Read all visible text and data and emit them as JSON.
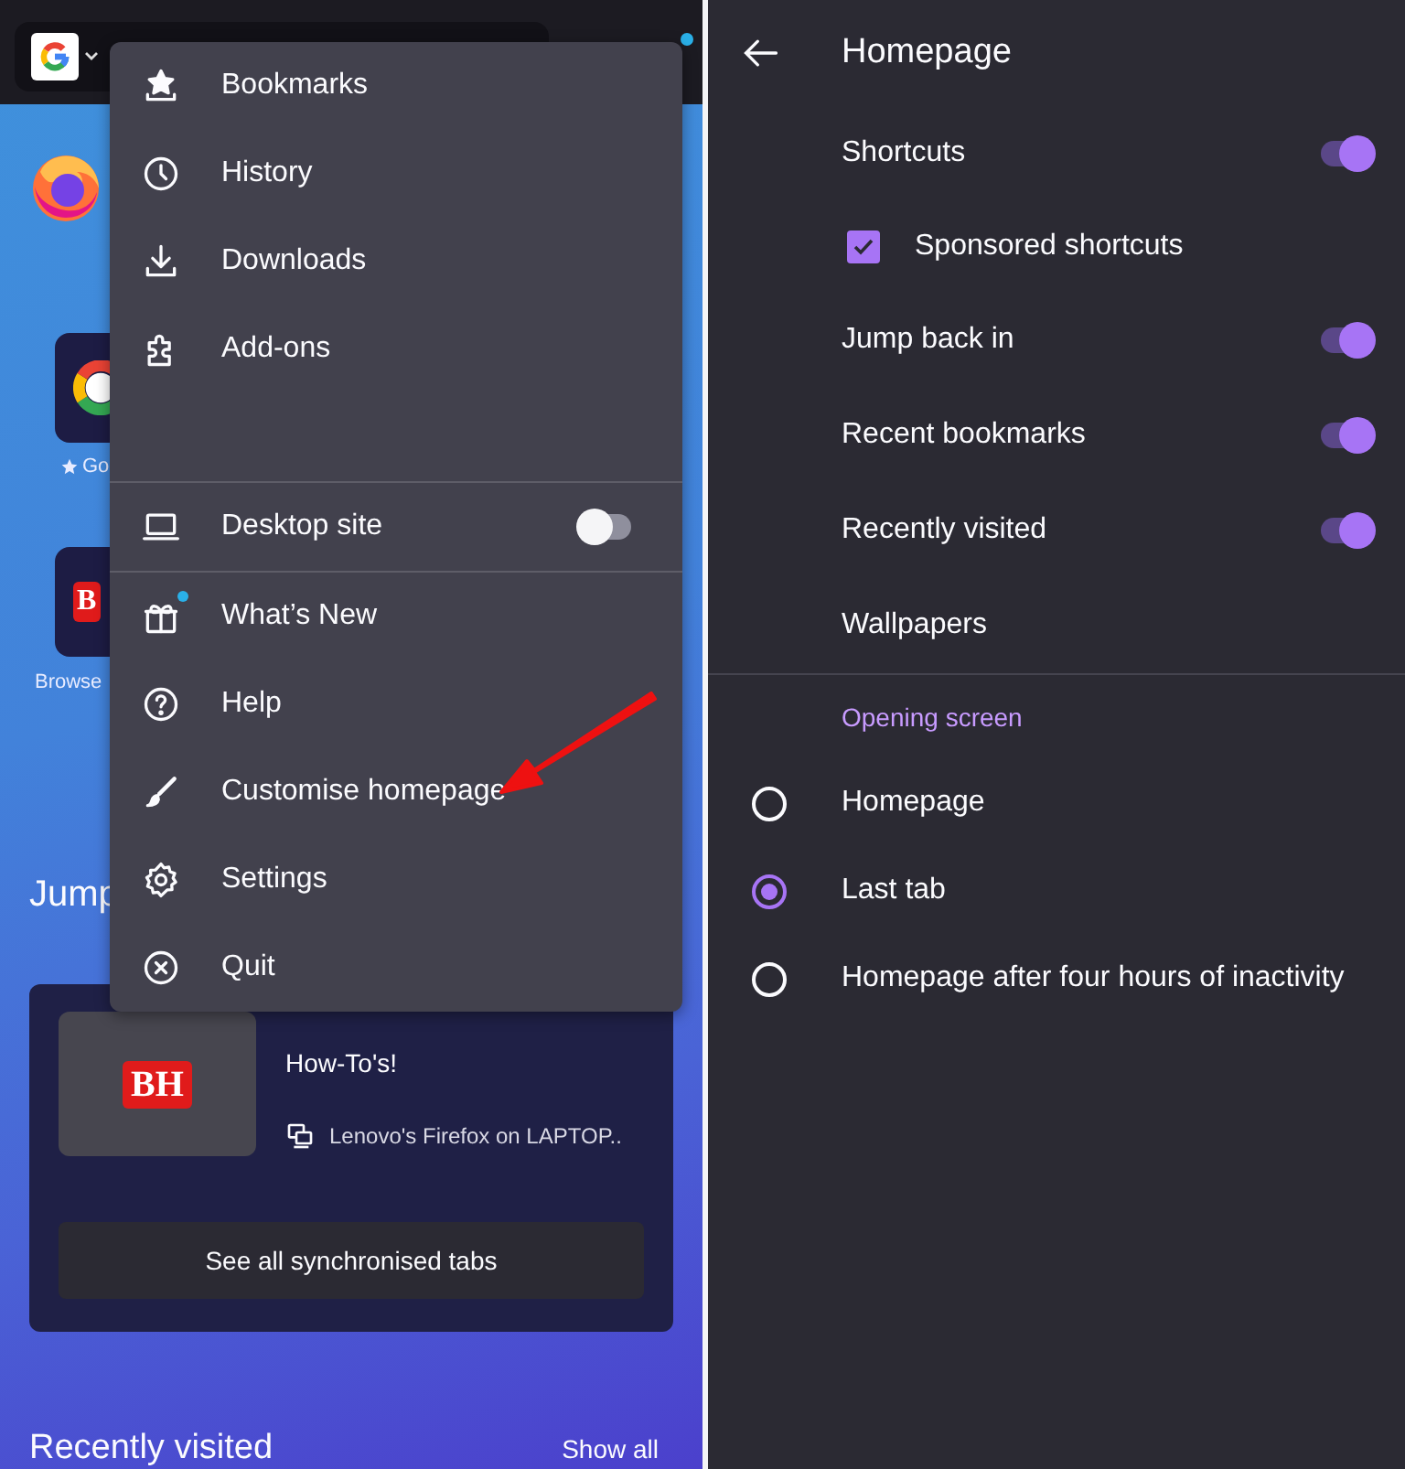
{
  "home": {
    "toolbar": {
      "notification": true
    },
    "shortcuts": [
      {
        "label": "Go"
      },
      {
        "logo": "B",
        "label": "Browse"
      }
    ],
    "jump_heading": "Jump",
    "synced_tab": {
      "logo": "BH",
      "title": "How-To's!",
      "device": "Lenovo's Firefox on LAPTOP..",
      "button": "See all synchronised tabs"
    },
    "recent": {
      "heading": "Recently visited",
      "action": "Show all"
    }
  },
  "menu": {
    "groups": [
      [
        {
          "kind": "item",
          "label": "Bookmarks",
          "badge": false
        },
        {
          "kind": "item",
          "label": "History",
          "badge": false
        },
        {
          "kind": "item",
          "label": "Downloads",
          "badge": false
        },
        {
          "kind": "item",
          "label": "Add-ons",
          "badge": false
        }
      ],
      [
        {
          "kind": "toggle",
          "label": "Desktop site",
          "badge": false,
          "on": false
        }
      ],
      [
        {
          "kind": "item",
          "label": "What’s New",
          "badge": true
        },
        {
          "kind": "item",
          "label": "Help",
          "badge": false
        },
        {
          "kind": "item",
          "label": "Customise homepage",
          "badge": false
        },
        {
          "kind": "item",
          "label": "Settings",
          "badge": false
        },
        {
          "kind": "item",
          "label": "Quit",
          "badge": false
        }
      ]
    ]
  },
  "settings": {
    "title": "Homepage",
    "rows": [
      {
        "kind": "toggle",
        "label": "Shortcuts",
        "on": true
      },
      {
        "kind": "checkbox",
        "label": "Sponsored shortcuts",
        "checked": true
      },
      {
        "kind": "toggle",
        "label": "Jump back in",
        "on": true
      },
      {
        "kind": "toggle",
        "label": "Recent bookmarks",
        "on": true
      },
      {
        "kind": "toggle",
        "label": "Recently visited",
        "on": true
      },
      {
        "kind": "link",
        "label": "Wallpapers"
      }
    ],
    "section": {
      "heading": "Opening screen",
      "options": [
        {
          "label": "Homepage",
          "selected": false
        },
        {
          "label": "Last tab",
          "selected": true
        },
        {
          "label": "Homepage after four hours of inactivity",
          "selected": false
        }
      ]
    }
  }
}
